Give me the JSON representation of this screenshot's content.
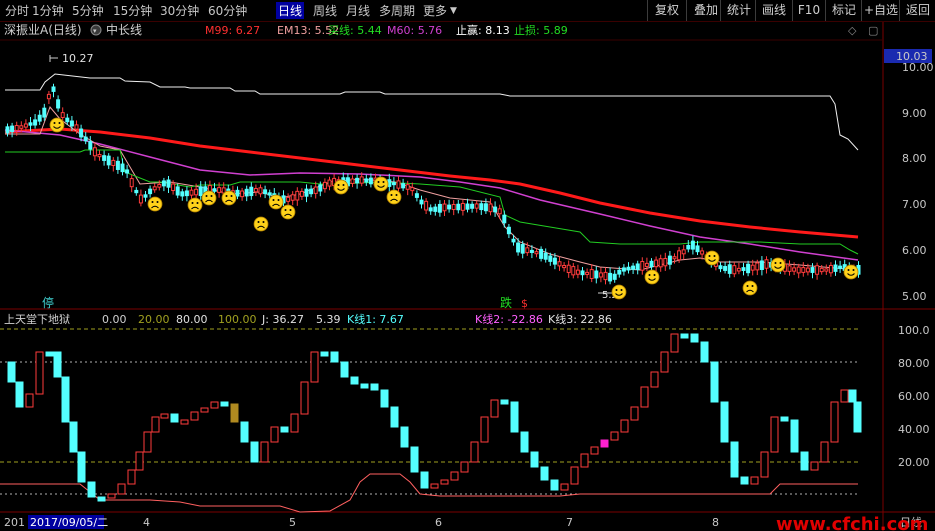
{
  "toolbar": {
    "periods": [
      "分时",
      "1分钟",
      "5分钟",
      "15分钟",
      "30分钟",
      "60分钟",
      "日线",
      "周线",
      "月线",
      "多周期",
      "更多"
    ],
    "active_period": "日线",
    "buttons": [
      "复权",
      "叠加",
      "统计",
      "画线",
      "F10",
      "标记",
      "+自选",
      "返回"
    ]
  },
  "main_panel": {
    "stock_title": "深振业A(日线)",
    "indicator_name": "中长线",
    "m99_label": "M99: 6.27",
    "em13_label": "EM13: 5.52",
    "buy_label": "买线: 5.44",
    "m60_label": "M60: 5.76",
    "take_profit_label": "止赢: 8.13",
    "stop_loss_label": "止损: 5.89",
    "price_axis_ticks": [
      "10.00",
      "9.00",
      "8.00",
      "7.00",
      "6.00",
      "5.00"
    ],
    "current_price_tag": "10.03",
    "max_price_label": "10.27",
    "min_price_label": "5.2",
    "ting_marker": "停",
    "die_marker": "跌",
    "s_marker": "$"
  },
  "sub_panel": {
    "indicator_name": "上天堂下地狱",
    "param_0": "0.00",
    "param_20": "20.00",
    "param_80": "80.00",
    "param_100": "100.00",
    "j_label": "J: 36.27",
    "value_539": "5.39",
    "k1_label": "K线1: 7.67",
    "k2_label": "K线2: -22.86",
    "k3_label": "K线3: 22.86",
    "axis_ticks": [
      "100.0",
      "80.00",
      "60.00",
      "40.00",
      "20.00"
    ]
  },
  "time_axis": {
    "year_fragment": "201",
    "cursor_date": "2017/09/05/二",
    "month_ticks": [
      "4",
      "5",
      "6",
      "7",
      "8"
    ],
    "right_label": "日线"
  },
  "watermark": "www.cfchi.com",
  "colors": {
    "background": "#000000",
    "up": "#ff3c3c",
    "down": "#54ffff",
    "m99": "#ff2020",
    "em13": "#f0a0a0",
    "buy_line": "#22cc22",
    "m60": "#d040d0",
    "take_profit": "#ffffff",
    "k_line": "#ff6060"
  }
}
